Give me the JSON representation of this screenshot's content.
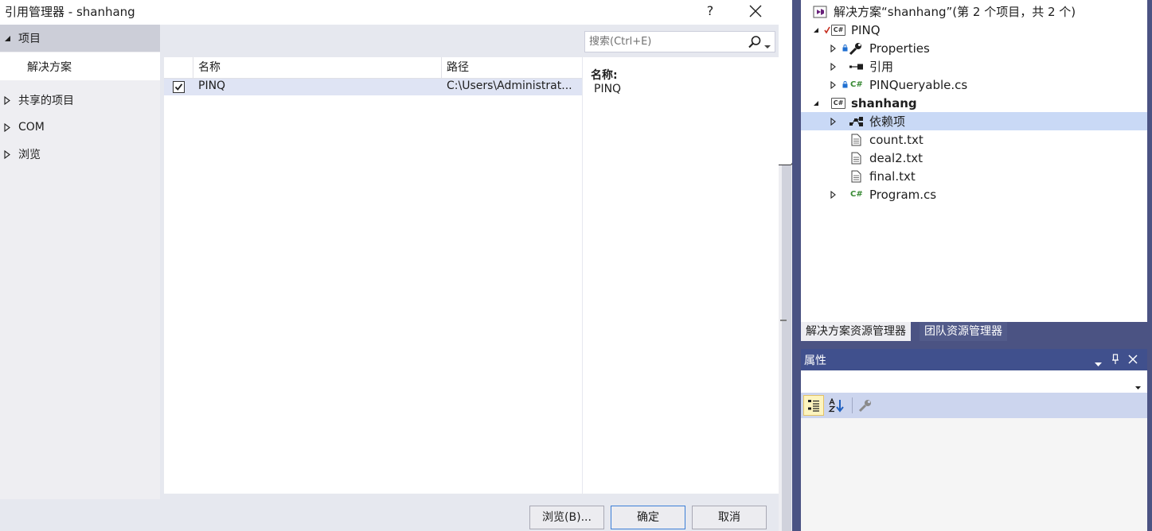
{
  "dialog": {
    "title": "引用管理器 - shanhang",
    "help_label": "?",
    "nav": {
      "projects": "项目",
      "solution": "解决方案",
      "shared": "共享的项目",
      "com": "COM",
      "browse": "浏览"
    },
    "search": {
      "placeholder": "搜索(Ctrl+E)"
    },
    "columns": {
      "name": "名称",
      "path": "路径"
    },
    "rows": [
      {
        "checked": true,
        "name": "PINQ",
        "path": "C:\\Users\\Administrat..."
      }
    ],
    "details": {
      "label": "名称:",
      "value": "PINQ"
    },
    "buttons": {
      "browse": "浏览(B)...",
      "ok": "确定",
      "cancel": "取消"
    }
  },
  "solution_explorer": {
    "solution_title": "解决方案“shanhang”(第 2 个项目，共 2 个)",
    "items": {
      "pinq": "PINQ",
      "properties": "Properties",
      "references": "引用",
      "pinqueryable": "PINQueryable.cs",
      "shanhang": "shanhang",
      "dependencies": "依赖项",
      "count": "count.txt",
      "deal2": "deal2.txt",
      "final": "final.txt",
      "program": "Program.cs"
    },
    "cs_badge": "C#",
    "tabs": {
      "solution_explorer": "解决方案资源管理器",
      "team_explorer": "团队资源管理器"
    }
  },
  "properties_panel": {
    "title": "属性"
  },
  "colors": {
    "accent_border": "#4b5383",
    "selection": "#c9d9f6",
    "csharp_green": "#388a34",
    "checkmark_red": "#c42b1c"
  }
}
